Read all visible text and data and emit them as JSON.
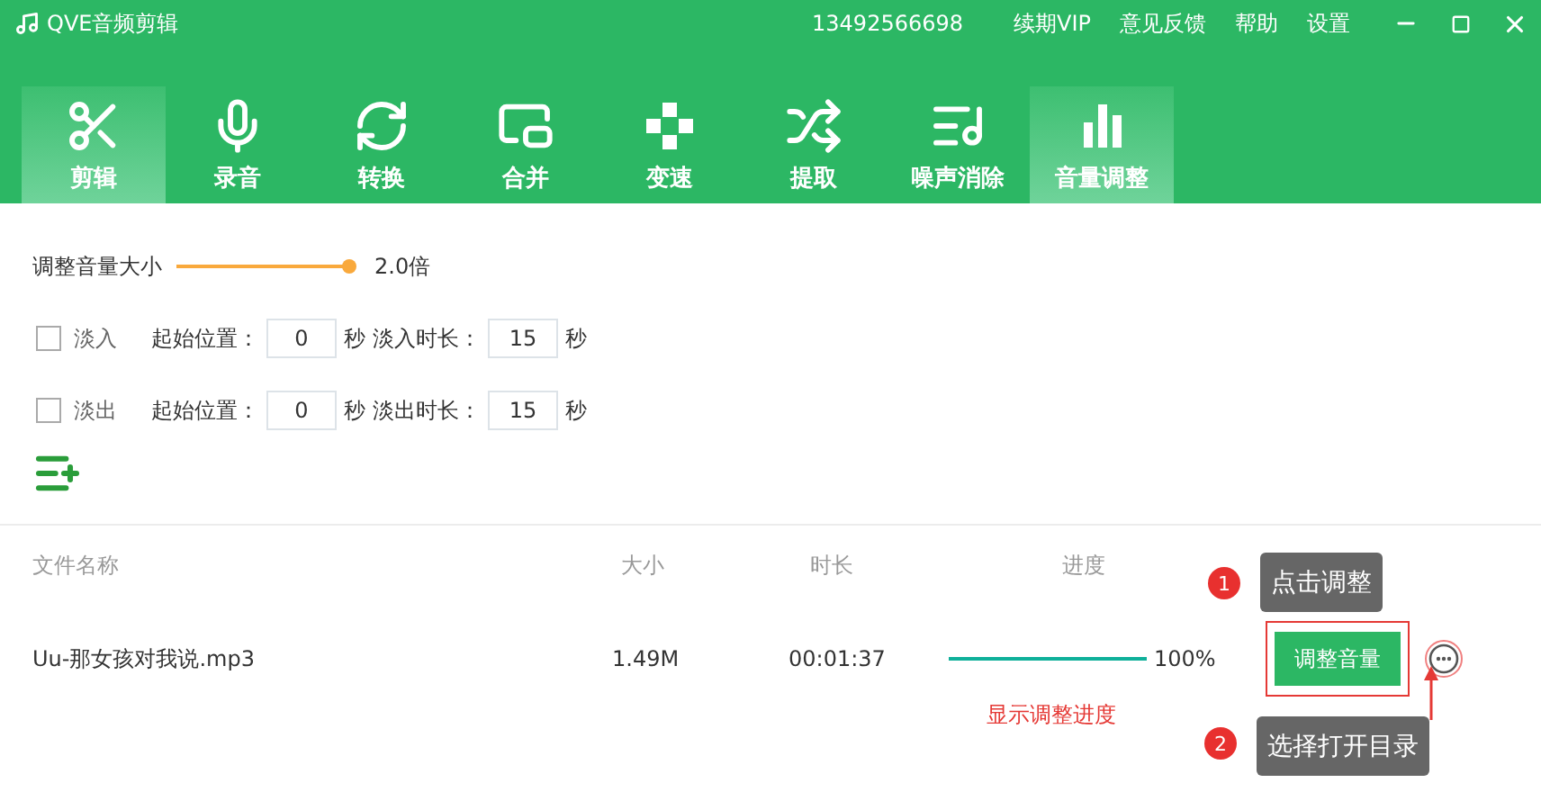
{
  "title_bar": {
    "title": "QVE音频剪辑",
    "account": "13492566698",
    "links": [
      "续期VIP",
      "意见反馈",
      "帮助",
      "设置"
    ]
  },
  "tabs": [
    {
      "label": "剪辑",
      "kind": "scissors",
      "selected": true
    },
    {
      "label": "录音",
      "kind": "mic",
      "selected": false
    },
    {
      "label": "转换",
      "kind": "convert",
      "selected": false
    },
    {
      "label": "合并",
      "kind": "merge",
      "selected": false
    },
    {
      "label": "变速",
      "kind": "speed",
      "selected": false
    },
    {
      "label": "提取",
      "kind": "extract",
      "selected": false
    },
    {
      "label": "噪声消除",
      "kind": "denoise",
      "selected": false
    },
    {
      "label": "音量调整",
      "kind": "volume",
      "selected": true
    }
  ],
  "volume": {
    "label": "调整音量大小",
    "level": 1,
    "reading": "2.0倍"
  },
  "fades": [
    {
      "label": "淡入",
      "checked": false,
      "start_label": "起始位置：",
      "start_value": "0",
      "start_unit": "秒",
      "duration_label": "淡入时长：",
      "duration_value": "15",
      "duration_unit": "秒"
    },
    {
      "label": "淡出",
      "checked": false,
      "start_label": "起始位置：",
      "start_value": "0",
      "start_unit": "秒",
      "duration_label": "淡出时长：",
      "duration_value": "15",
      "duration_unit": "秒"
    }
  ],
  "file_table": {
    "columns": [
      "文件名称",
      "大小",
      "时长",
      "进度"
    ],
    "rows": [
      {
        "name": "Uu-那女孩对我说.mp3",
        "size": "1.49M",
        "duration": "00:01:37",
        "level": 1,
        "percent": "100%",
        "action": "调整音量"
      }
    ]
  },
  "progress_note": "显示调整进度",
  "annotations": [
    {
      "number": "1",
      "text": "点击调整"
    },
    {
      "number": "2",
      "text": "选择打开目录"
    }
  ]
}
